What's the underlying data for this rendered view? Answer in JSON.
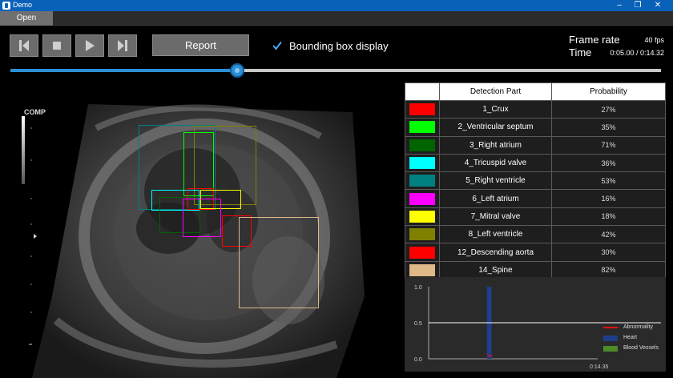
{
  "window": {
    "title": "Demo"
  },
  "menu": {
    "open_label": "Open"
  },
  "toolbar": {
    "report_label": "Report",
    "bbox_display_label": "Bounding box display",
    "bbox_display_checked": true
  },
  "status": {
    "frame_rate_label": "Frame rate",
    "frame_rate_value": "40 fps",
    "time_label": "Time",
    "time_value": "0:05.00 / 0:14.32"
  },
  "playback": {
    "progress_fraction": 0.349
  },
  "image": {
    "comp_label": "COMP"
  },
  "table": {
    "headers": [
      "",
      "Detection Part",
      "Probability"
    ],
    "rows": [
      {
        "color": "#ff0000",
        "part": "1_Crux",
        "probability": "27%"
      },
      {
        "color": "#00ff00",
        "part": "2_Ventricular septum",
        "probability": "35%"
      },
      {
        "color": "#006400",
        "part": "3_Right atrium",
        "probability": "71%"
      },
      {
        "color": "#00ffff",
        "part": "4_Tricuspid valve",
        "probability": "36%"
      },
      {
        "color": "#008080",
        "part": "5_Right ventricle",
        "probability": "53%"
      },
      {
        "color": "#ff00ff",
        "part": "6_Left atrium",
        "probability": "16%"
      },
      {
        "color": "#ffff00",
        "part": "7_Mitral valve",
        "probability": "18%"
      },
      {
        "color": "#808000",
        "part": "8_Left ventricle",
        "probability": "42%"
      },
      {
        "color": "#ff0000",
        "part": "12_Descending aorta",
        "probability": "30%"
      },
      {
        "color": "#deb887",
        "part": "14_Spine",
        "probability": "82%"
      }
    ]
  },
  "chart_data": {
    "type": "bar",
    "y_ticks": [
      "1.0",
      "0.5",
      "0.0"
    ],
    "ylim": [
      0,
      1
    ],
    "threshold": 0.5,
    "x_end_label": "0:14.35",
    "x_end_seconds": 14.35,
    "bar": {
      "series": "Heart",
      "start_seconds": 4.95,
      "end_seconds": 5.35,
      "value": 1.0
    },
    "series": [
      {
        "name": "Abnormality",
        "color": "#e01010"
      },
      {
        "name": "Heart",
        "color": "#1f3d88"
      },
      {
        "name": "Blood Vessels",
        "color": "#4c8a2a"
      }
    ]
  }
}
